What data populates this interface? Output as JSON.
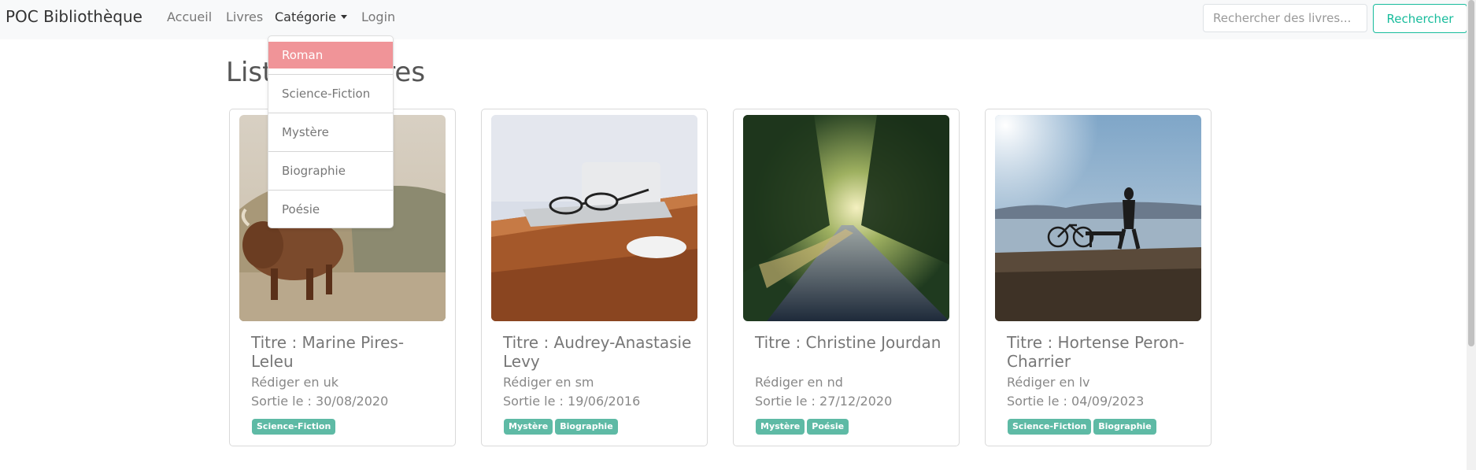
{
  "navbar": {
    "brand": "POC Bibliothèque",
    "links": {
      "home": "Accueil",
      "books": "Livres",
      "category": "Catégorie",
      "login": "Login"
    },
    "search_placeholder": "Rechercher des livres...",
    "search_button": "Rechercher"
  },
  "dropdown": {
    "items": [
      "Roman",
      "Science-Fiction",
      "Mystère",
      "Biographie",
      "Poésie"
    ],
    "active_index": 0
  },
  "page": {
    "title": "Liste des livres"
  },
  "books": [
    {
      "title": "Titre : Marine Pires-Leleu",
      "language": "Rédiger en uk",
      "release": "Sortie le : 30/08/2020",
      "tags": [
        "Science-Fiction"
      ],
      "image": "highland-cow"
    },
    {
      "title": "Titre : Audrey-Anastasie Levy",
      "language": "Rédiger en sm",
      "release": "Sortie le : 19/06/2016",
      "tags": [
        "Mystère",
        "Biographie"
      ],
      "image": "desk-laptop-glasses"
    },
    {
      "title": "Titre : Christine Jourdan",
      "language": "Rédiger en nd",
      "release": "Sortie le : 27/12/2020",
      "tags": [
        "Mystère",
        "Poésie"
      ],
      "image": "forest-road"
    },
    {
      "title": "Titre : Hortense Peron-Charrier",
      "language": "Rédiger en lv",
      "release": "Sortie le : 04/09/2023",
      "tags": [
        "Science-Fiction",
        "Biographie"
      ],
      "image": "waterfront-bicycle"
    }
  ],
  "colors": {
    "navbar_bg": "#f8f9fa",
    "accent": "#18bc9c",
    "badge": "#5ebaa5",
    "dropdown_active": "#f09498"
  }
}
